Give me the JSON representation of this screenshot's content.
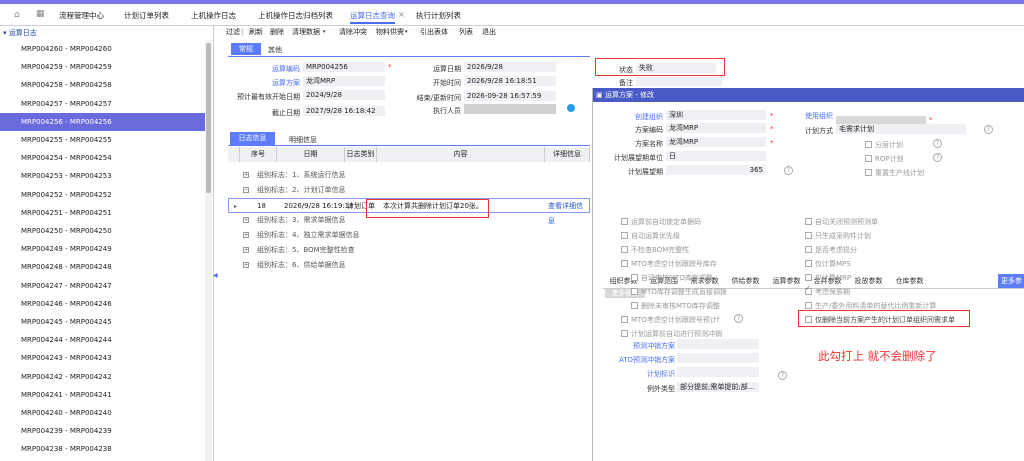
{
  "tabs": [
    "流程管理中心",
    "计划订单列表",
    "上机操作日志",
    "上机操作日志归档列表",
    "运算日志查询",
    "执行计划列表"
  ],
  "active_tab_index": 4,
  "left": {
    "header": "运算日志",
    "items": [
      "MRP004260 - MRP004260",
      "MRP004259 - MRP004259",
      "MRP004258 - MRP004258",
      "MRP004257 - MRP004257",
      "MRP004256 - MRP004256",
      "MRP004255 - MRP004255",
      "MRP004254 - MRP004254",
      "MRP004253 - MRP004253",
      "MRP004252 - MRP004252",
      "MRP004251 - MRP004251",
      "MRP004250 - MRP004250",
      "MRP004249 - MRP004249",
      "MRP004248 - MRP004248",
      "MRP004247 - MRP004247",
      "MRP004246 - MRP004246",
      "MRP004245 - MRP004245",
      "MRP004244 - MRP004244",
      "MRP004243 - MRP004243",
      "MRP004242 - MRP004242",
      "MRP004241 - MRP004241",
      "MRP004240 - MRP004240",
      "MRP004239 - MRP004239",
      "MRP004238 - MRP004238"
    ],
    "selected_index": 4
  },
  "toolbar": [
    "过滤",
    "刷新",
    "删除",
    "清理数据",
    "清除冲突",
    "物料供需",
    "引出表体",
    "列表",
    "退出"
  ],
  "subtabs": [
    "常规",
    "其他"
  ],
  "form": {
    "code_label": "运算编码",
    "code": "MRP004256",
    "plan_label": "运算方案",
    "plan": "龙湾MRP",
    "prestart_label": "预计最有效开始日期",
    "prestart": "2024/9/28",
    "end_label": "截止日期",
    "end": "2027/9/28 16:18:42",
    "date_label": "运算日期",
    "date": "2026/9/28",
    "start_label": "开始时间",
    "start": "2026/9/28 16:18:51",
    "finish_label": "结束/更新时间",
    "finish": "2026-09-28 16:57:59",
    "exec_label": "执行人员",
    "status_label": "状态",
    "status": "失败",
    "remark_label": "备注"
  },
  "log_tabs": [
    "日志信息",
    "明细信息"
  ],
  "grid": {
    "headers": [
      "序号",
      "日期",
      "日志类别",
      "内容",
      "详细信息"
    ],
    "groups": [
      "组别标志：1、系统运行信息",
      "组别标志：2、计划订单信息",
      "组别标志：3、需求单据信息",
      "组别标志：4、独立需求单据信息",
      "组别标志：5、BOM完整性检查",
      "组别标志：6、供给单据信息"
    ],
    "row": {
      "seq": "18",
      "date": "2026/9/28 16:19:18",
      "type": "计划订单",
      "content": "本次计算共删除计划订单20张。",
      "link": "查看详细信息"
    }
  },
  "dialog": {
    "title": "运算方案 - 修改",
    "create_org_label": "创建组织",
    "create_org": "深圳",
    "use_org_label": "使用组织",
    "code_label": "方案编码",
    "code": "龙湾MRP",
    "name_label": "方案名称",
    "name": "龙湾MRP",
    "unit_label": "计划展望期单位",
    "unit": "日",
    "horizon_label": "计划展望期",
    "horizon": "365",
    "method_label": "计划方式",
    "method": "毛需求计划",
    "opts_top": [
      "分层计划",
      "ROP计划",
      "重置生产线计划"
    ],
    "tabs": [
      "组织参数",
      "运算范围",
      "需求参数",
      "供给参数",
      "运算参数",
      "合并参数",
      "投放参数",
      "仓库参数",
      "更多参数"
    ],
    "active_tab": 8,
    "section": "更多参数",
    "left_checks": [
      "运算前自动锁定单据码",
      "自动运算优先级",
      "不检查BOM完整性",
      "MTO考虑空计划跟踪号库存",
      "自动审核MTO库存调整",
      "MTO库存调整生成直接调拨",
      "删除未审核MTO库存调整",
      "MTO考虑空计划跟踪号预计f",
      "计划运算前自动进行预测冲销"
    ],
    "right_checks": [
      "自动关闭预测预测单",
      "只生成采购件计划",
      "是否考虑损分",
      "仅计算MPS",
      "仅计算MRP",
      "考虑保质期",
      "生产/委外用料清单的替代比例重新计算",
      "仅删除当前方案产生的计划订单组织间需求单"
    ],
    "forecast_label": "预测冲销方案",
    "atp_label": "ATO预测冲销方案",
    "plan_mark_label": "计划标识",
    "exception_label": "例外类型",
    "exception": "部分提前;需单提前;部..."
  },
  "annotation": "此勾打上 就不会删除了"
}
